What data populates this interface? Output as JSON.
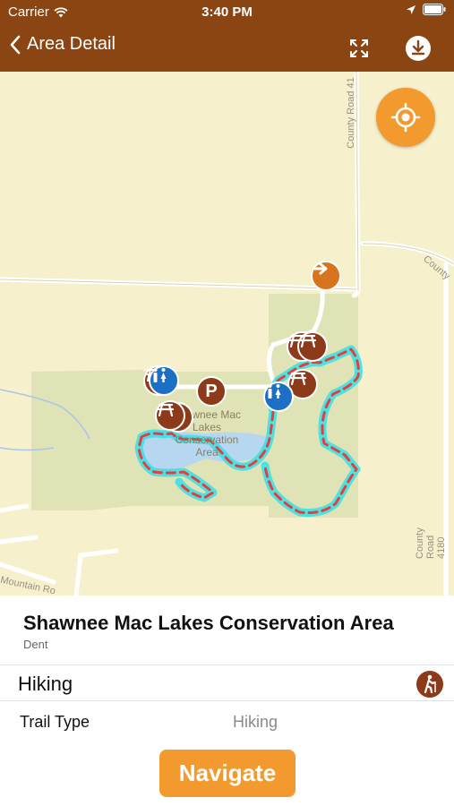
{
  "status_bar": {
    "carrier": "Carrier",
    "time": "3:40 PM",
    "wifi_icon": "wifi-icon",
    "location_icon": "location-arrow-icon",
    "battery_icon": "battery-icon"
  },
  "header": {
    "back_label": "Area Detail",
    "fullscreen_icon": "fullscreen-icon",
    "download_icon": "download-icon",
    "background": "#8b4513"
  },
  "map": {
    "area_label_lines": [
      "Shawnee Mac",
      "Lakes",
      "Conservation",
      "Area"
    ],
    "road_labels": [
      "County Road 41",
      "County",
      "County Road 4180",
      "Mountain Ro"
    ],
    "parking_label": "P",
    "trail_color": "#e04040",
    "trail_glow": "#36e0e8",
    "locate_button_color": "#f39a2e"
  },
  "detail": {
    "title": "Shawnee Mac Lakes Conservation Area",
    "subtitle": "Dent",
    "activity": "Hiking",
    "activity_icon": "hiker-icon",
    "row_label": "Trail Type",
    "row_value": "Hiking",
    "navigate_label": "Navigate",
    "accent": "#f39a2e"
  }
}
